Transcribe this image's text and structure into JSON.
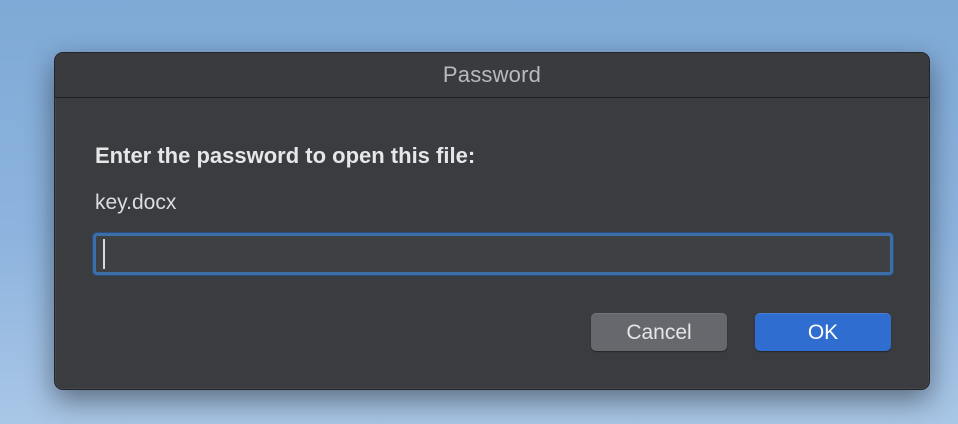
{
  "dialog": {
    "title": "Password",
    "prompt": "Enter the password to open this file:",
    "filename": "key.docx",
    "password_value": "",
    "cancel_label": "Cancel",
    "ok_label": "OK"
  },
  "colors": {
    "dialog_bg": "#3b3c3f",
    "focus_ring": "#3e6ea8",
    "ok_button": "#2f6dd0",
    "cancel_button": "#66686d"
  }
}
